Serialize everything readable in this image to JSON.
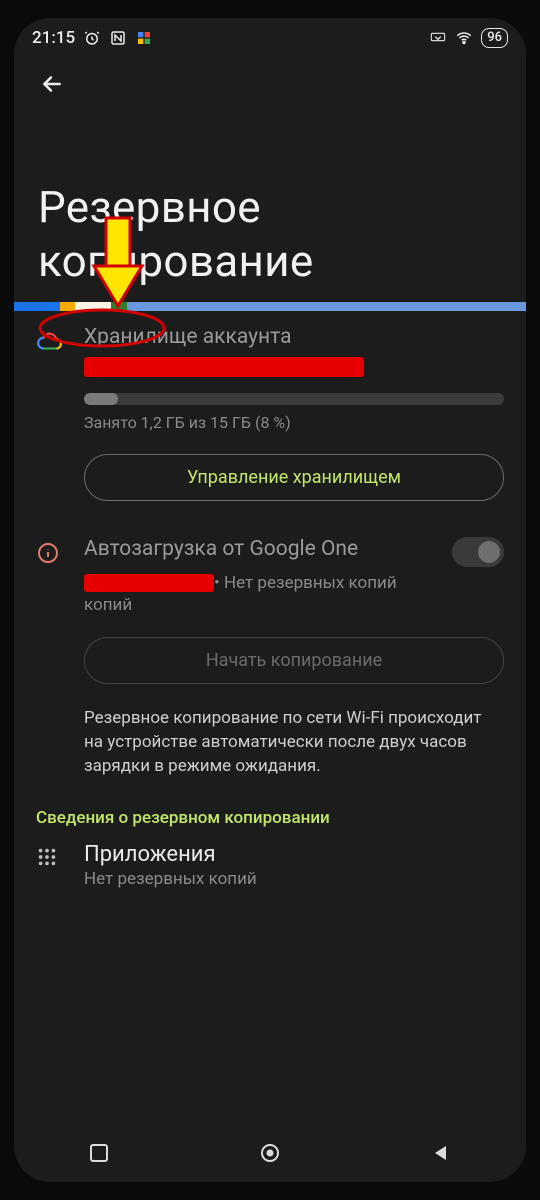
{
  "statusbar": {
    "time": "21:15",
    "battery_pct": "96"
  },
  "page": {
    "title": "Резервное копирование"
  },
  "segmented_bar": {
    "segments": [
      {
        "color": "#1a73e8",
        "width": 9
      },
      {
        "color": "#f9ab00",
        "width": 3
      },
      {
        "color": "#f8f3e3",
        "width": 7
      },
      {
        "color": "#2e7d32",
        "width": 3
      },
      {
        "color": "#6a98df",
        "width": 78
      }
    ]
  },
  "storage": {
    "title": "Хранилище аккаунта",
    "usage_text": "Занято 1,2 ГБ из 15 ГБ (8 %)",
    "usage_pct": 8,
    "manage_label": "Управление хранилищем"
  },
  "google_one": {
    "title": "Автозагрузка от Google One",
    "status_suffix": " • Нет резервных копий",
    "toggle_on": false,
    "start_label": "Начать копирование"
  },
  "note": "Резервное копирование по сети Wi-Fi происходит на устройстве автоматически после двух часов зарядки в режиме ожидания.",
  "backup_info_header": "Сведения о резервном копировании",
  "apps": {
    "title": "Приложения",
    "sub": "Нет резервных копий"
  },
  "colors": {
    "accent": "#c3e66a",
    "redact": "#e60000",
    "arrow_fill": "#ffe600",
    "arrow_stroke": "#d10000"
  }
}
